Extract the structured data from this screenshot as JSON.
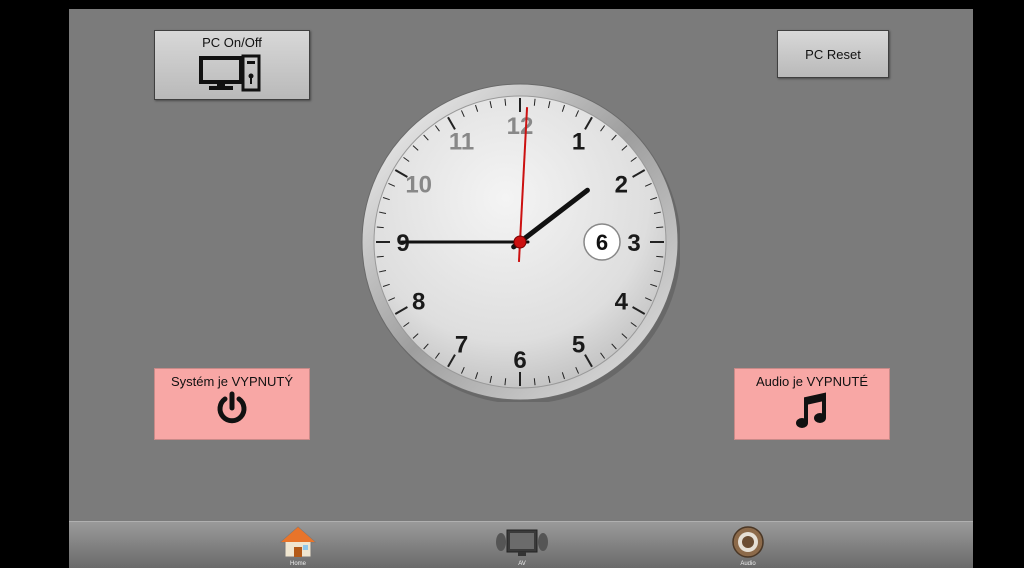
{
  "buttons": {
    "pc_onoff_label": "PC On/Off",
    "pc_reset_label": "PC Reset"
  },
  "status": {
    "system_label": "Systém je VYPNUTÝ",
    "audio_label": "Audio je VYPNUTÉ",
    "color": "#f8a7a5"
  },
  "clock": {
    "numbers": [
      "12",
      "1",
      "2",
      "3",
      "4",
      "5",
      "6",
      "7",
      "8",
      "9",
      "10",
      "11"
    ],
    "date_label": "6",
    "time": {
      "hour": 1,
      "minute": 45,
      "second": 0
    }
  },
  "nav": {
    "items": [
      {
        "label": "Home",
        "icon": "house-icon"
      },
      {
        "label": "AV",
        "icon": "tv-speakers-icon"
      },
      {
        "label": "Audio",
        "icon": "speaker-icon"
      }
    ]
  },
  "colors": {
    "panel": "#7b7b7b",
    "second_hand": "#cc1111",
    "status_bg": "#f8a7a5"
  }
}
